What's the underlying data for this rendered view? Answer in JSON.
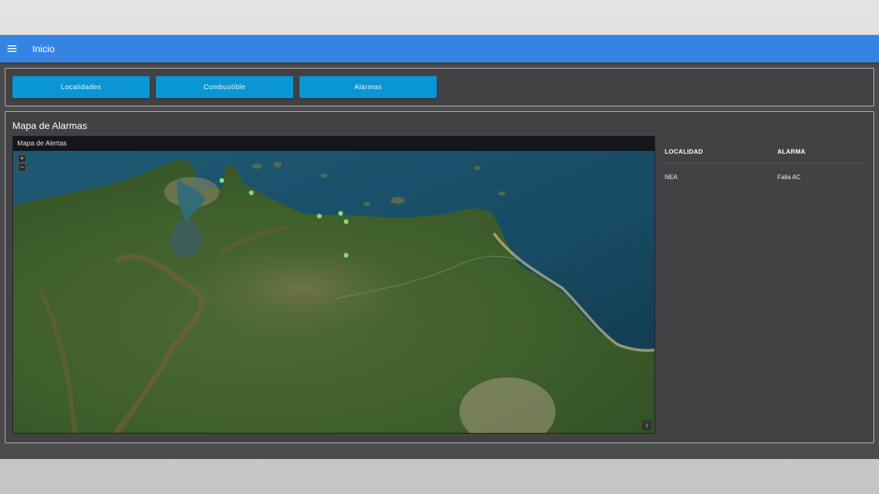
{
  "appbar": {
    "menu_icon": "menu-icon",
    "title": "Inicio",
    "color": "#3584e4"
  },
  "nav_buttons": [
    {
      "label": "Localidades"
    },
    {
      "label": "Combustible"
    },
    {
      "label": "Alarmas"
    }
  ],
  "map_card": {
    "title": "Mapa de Alarmas",
    "map_header": "Mapa de Alertas",
    "zoom_in": "+",
    "zoom_out": "−",
    "info": "i",
    "marker_color": "#7ddc7a"
  },
  "table": {
    "headers": [
      "LOCALIDAD",
      "ALARMA"
    ],
    "rows": [
      [
        "NEA",
        "Falla AC"
      ]
    ]
  }
}
